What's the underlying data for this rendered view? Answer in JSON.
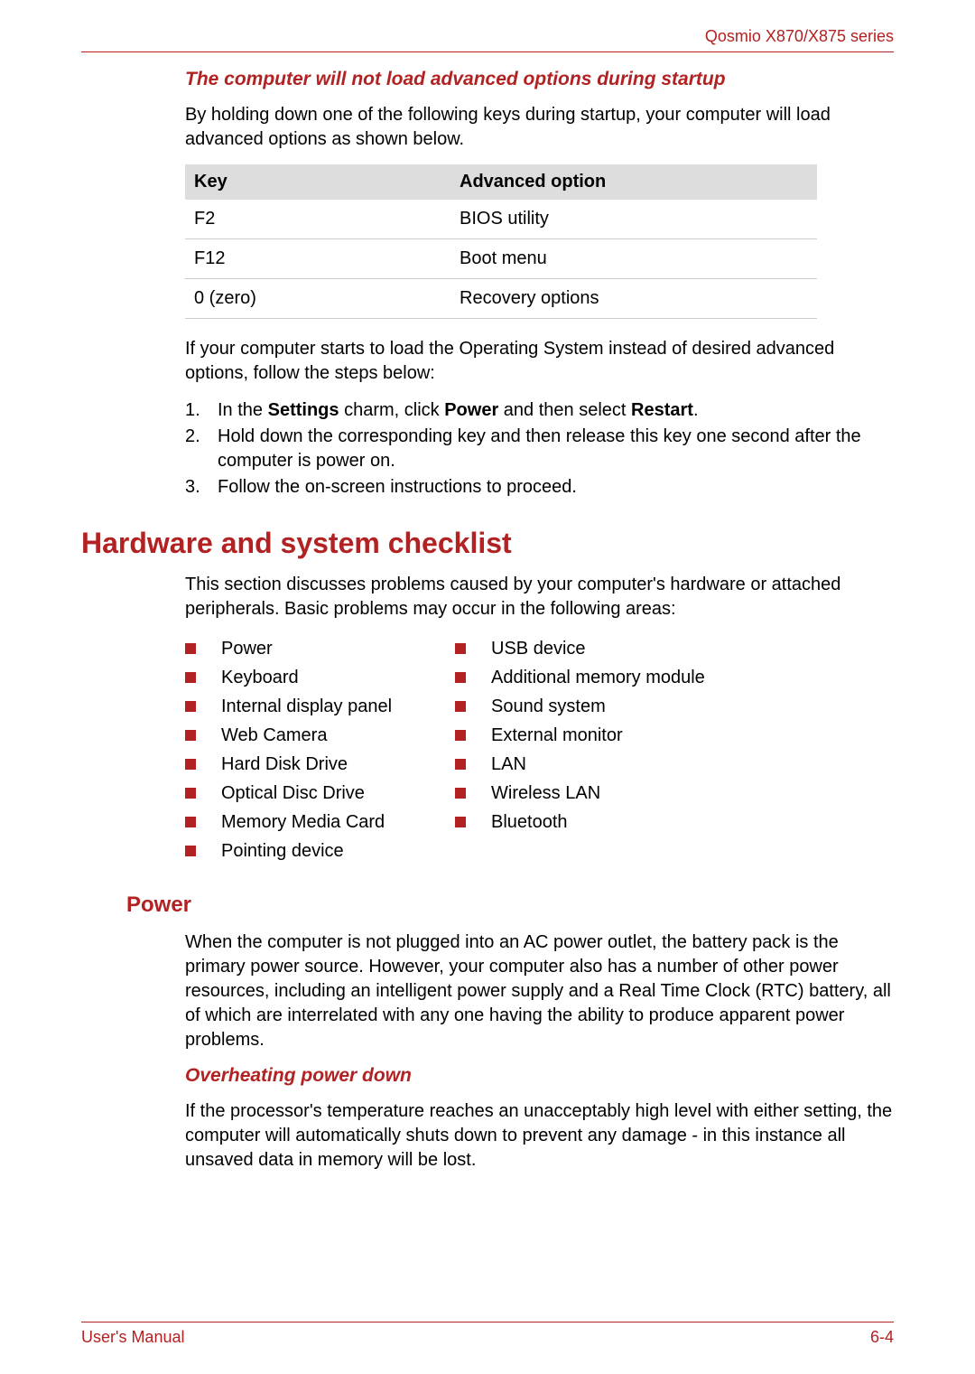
{
  "header": {
    "series": "Qosmio X870/X875 series"
  },
  "section1": {
    "heading": "The computer will not load advanced options during startup",
    "intro": "By holding down one of the following keys during startup, your computer will load advanced options as shown below.",
    "table": {
      "head_key": "Key",
      "head_option": "Advanced option",
      "rows": [
        {
          "key": "F2",
          "option": "BIOS utility"
        },
        {
          "key": "F12",
          "option": "Boot menu"
        },
        {
          "key": "0 (zero)",
          "option": "Recovery options"
        }
      ]
    },
    "after_table": "If your computer starts to load the Operating System instead of desired advanced options, follow the steps below:",
    "steps": {
      "s1_pre": "In the ",
      "s1_b1": "Settings",
      "s1_mid": " charm, click ",
      "s1_b2": "Power",
      "s1_mid2": " and then select ",
      "s1_b3": "Restart",
      "s1_end": ".",
      "s2": "Hold down the corresponding key and then release this key one second after the computer is power on.",
      "s3": "Follow the on-screen instructions to proceed."
    }
  },
  "hw": {
    "heading": "Hardware and system checklist",
    "intro": "This section discusses problems caused by your computer's hardware or attached peripherals. Basic problems may occur in the following areas:",
    "col1": [
      "Power",
      "Keyboard",
      "Internal display panel",
      "Web Camera",
      "Hard Disk Drive",
      "Optical Disc Drive",
      "Memory Media Card",
      "Pointing device"
    ],
    "col2": [
      "USB device",
      "Additional memory module",
      "Sound system",
      "External monitor",
      "LAN",
      "Wireless LAN",
      "Bluetooth"
    ]
  },
  "power": {
    "heading": "Power",
    "body": "When the computer is not plugged into an AC power outlet, the battery pack is the primary power source. However, your computer also has a number of other power resources, including an intelligent power supply and a Real Time Clock (RTC) battery, all of which are interrelated with any one having the ability to produce apparent power problems.",
    "sub_heading": "Overheating power down",
    "sub_body": "If the processor's temperature reaches an unacceptably high level with either setting, the computer will automatically shuts down to prevent any damage - in this instance all unsaved data in memory will be lost."
  },
  "footer": {
    "manual": "User's Manual",
    "page": "6-4"
  },
  "nums": {
    "n1": "1.",
    "n2": "2.",
    "n3": "3."
  }
}
